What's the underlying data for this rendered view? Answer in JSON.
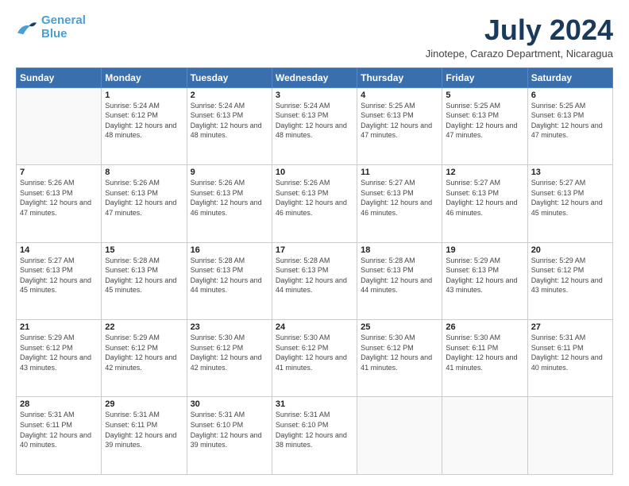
{
  "logo": {
    "line1": "General",
    "line2": "Blue"
  },
  "title": {
    "month_year": "July 2024",
    "location": "Jinotepe, Carazo Department, Nicaragua"
  },
  "weekdays": [
    "Sunday",
    "Monday",
    "Tuesday",
    "Wednesday",
    "Thursday",
    "Friday",
    "Saturday"
  ],
  "weeks": [
    [
      {
        "day": "",
        "sunrise": "",
        "sunset": "",
        "daylight": ""
      },
      {
        "day": "1",
        "sunrise": "5:24 AM",
        "sunset": "6:12 PM",
        "daylight": "12 hours and 48 minutes."
      },
      {
        "day": "2",
        "sunrise": "5:24 AM",
        "sunset": "6:13 PM",
        "daylight": "12 hours and 48 minutes."
      },
      {
        "day": "3",
        "sunrise": "5:24 AM",
        "sunset": "6:13 PM",
        "daylight": "12 hours and 48 minutes."
      },
      {
        "day": "4",
        "sunrise": "5:25 AM",
        "sunset": "6:13 PM",
        "daylight": "12 hours and 47 minutes."
      },
      {
        "day": "5",
        "sunrise": "5:25 AM",
        "sunset": "6:13 PM",
        "daylight": "12 hours and 47 minutes."
      },
      {
        "day": "6",
        "sunrise": "5:25 AM",
        "sunset": "6:13 PM",
        "daylight": "12 hours and 47 minutes."
      }
    ],
    [
      {
        "day": "7",
        "sunrise": "5:26 AM",
        "sunset": "6:13 PM",
        "daylight": "12 hours and 47 minutes."
      },
      {
        "day": "8",
        "sunrise": "5:26 AM",
        "sunset": "6:13 PM",
        "daylight": "12 hours and 47 minutes."
      },
      {
        "day": "9",
        "sunrise": "5:26 AM",
        "sunset": "6:13 PM",
        "daylight": "12 hours and 46 minutes."
      },
      {
        "day": "10",
        "sunrise": "5:26 AM",
        "sunset": "6:13 PM",
        "daylight": "12 hours and 46 minutes."
      },
      {
        "day": "11",
        "sunrise": "5:27 AM",
        "sunset": "6:13 PM",
        "daylight": "12 hours and 46 minutes."
      },
      {
        "day": "12",
        "sunrise": "5:27 AM",
        "sunset": "6:13 PM",
        "daylight": "12 hours and 46 minutes."
      },
      {
        "day": "13",
        "sunrise": "5:27 AM",
        "sunset": "6:13 PM",
        "daylight": "12 hours and 45 minutes."
      }
    ],
    [
      {
        "day": "14",
        "sunrise": "5:27 AM",
        "sunset": "6:13 PM",
        "daylight": "12 hours and 45 minutes."
      },
      {
        "day": "15",
        "sunrise": "5:28 AM",
        "sunset": "6:13 PM",
        "daylight": "12 hours and 45 minutes."
      },
      {
        "day": "16",
        "sunrise": "5:28 AM",
        "sunset": "6:13 PM",
        "daylight": "12 hours and 44 minutes."
      },
      {
        "day": "17",
        "sunrise": "5:28 AM",
        "sunset": "6:13 PM",
        "daylight": "12 hours and 44 minutes."
      },
      {
        "day": "18",
        "sunrise": "5:28 AM",
        "sunset": "6:13 PM",
        "daylight": "12 hours and 44 minutes."
      },
      {
        "day": "19",
        "sunrise": "5:29 AM",
        "sunset": "6:13 PM",
        "daylight": "12 hours and 43 minutes."
      },
      {
        "day": "20",
        "sunrise": "5:29 AM",
        "sunset": "6:12 PM",
        "daylight": "12 hours and 43 minutes."
      }
    ],
    [
      {
        "day": "21",
        "sunrise": "5:29 AM",
        "sunset": "6:12 PM",
        "daylight": "12 hours and 43 minutes."
      },
      {
        "day": "22",
        "sunrise": "5:29 AM",
        "sunset": "6:12 PM",
        "daylight": "12 hours and 42 minutes."
      },
      {
        "day": "23",
        "sunrise": "5:30 AM",
        "sunset": "6:12 PM",
        "daylight": "12 hours and 42 minutes."
      },
      {
        "day": "24",
        "sunrise": "5:30 AM",
        "sunset": "6:12 PM",
        "daylight": "12 hours and 41 minutes."
      },
      {
        "day": "25",
        "sunrise": "5:30 AM",
        "sunset": "6:12 PM",
        "daylight": "12 hours and 41 minutes."
      },
      {
        "day": "26",
        "sunrise": "5:30 AM",
        "sunset": "6:11 PM",
        "daylight": "12 hours and 41 minutes."
      },
      {
        "day": "27",
        "sunrise": "5:31 AM",
        "sunset": "6:11 PM",
        "daylight": "12 hours and 40 minutes."
      }
    ],
    [
      {
        "day": "28",
        "sunrise": "5:31 AM",
        "sunset": "6:11 PM",
        "daylight": "12 hours and 40 minutes."
      },
      {
        "day": "29",
        "sunrise": "5:31 AM",
        "sunset": "6:11 PM",
        "daylight": "12 hours and 39 minutes."
      },
      {
        "day": "30",
        "sunrise": "5:31 AM",
        "sunset": "6:10 PM",
        "daylight": "12 hours and 39 minutes."
      },
      {
        "day": "31",
        "sunrise": "5:31 AM",
        "sunset": "6:10 PM",
        "daylight": "12 hours and 38 minutes."
      },
      {
        "day": "",
        "sunrise": "",
        "sunset": "",
        "daylight": ""
      },
      {
        "day": "",
        "sunrise": "",
        "sunset": "",
        "daylight": ""
      },
      {
        "day": "",
        "sunrise": "",
        "sunset": "",
        "daylight": ""
      }
    ]
  ],
  "labels": {
    "sunrise": "Sunrise:",
    "sunset": "Sunset:",
    "daylight": "Daylight:"
  }
}
